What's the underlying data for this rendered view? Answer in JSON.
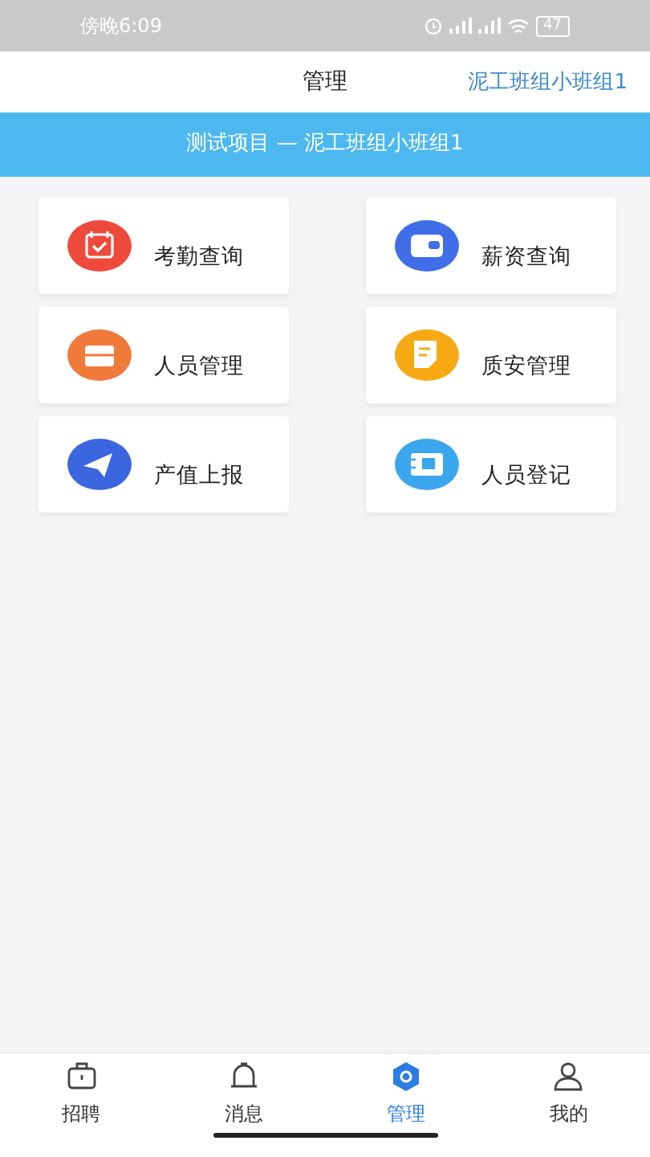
{
  "status_bar": {
    "time": "傍晚6:09",
    "battery": "47"
  },
  "header": {
    "title": "管理",
    "team": "泥工班组小班组1"
  },
  "banner": {
    "text": "测试项目 — 泥工班组小班组1"
  },
  "menu": [
    {
      "label": "考勤查询",
      "kind": "calendar",
      "color": "#ee4a3c"
    },
    {
      "label": "薪资查询",
      "kind": "wallet",
      "color": "#3f6ee8"
    },
    {
      "label": "人员管理",
      "kind": "briefcase",
      "color": "#f07a3a"
    },
    {
      "label": "质安管理",
      "kind": "note",
      "color": "#f6a912"
    },
    {
      "label": "产值上报",
      "kind": "plane",
      "color": "#3b66e0"
    },
    {
      "label": "人员登记",
      "kind": "card",
      "color": "#3aa6ee"
    }
  ],
  "tabs": [
    {
      "label": "招聘",
      "kind": "bag",
      "selected": false
    },
    {
      "label": "消息",
      "kind": "bell",
      "selected": false
    },
    {
      "label": "管理",
      "kind": "hex",
      "selected": true
    },
    {
      "label": "我的",
      "kind": "user",
      "selected": false
    }
  ]
}
